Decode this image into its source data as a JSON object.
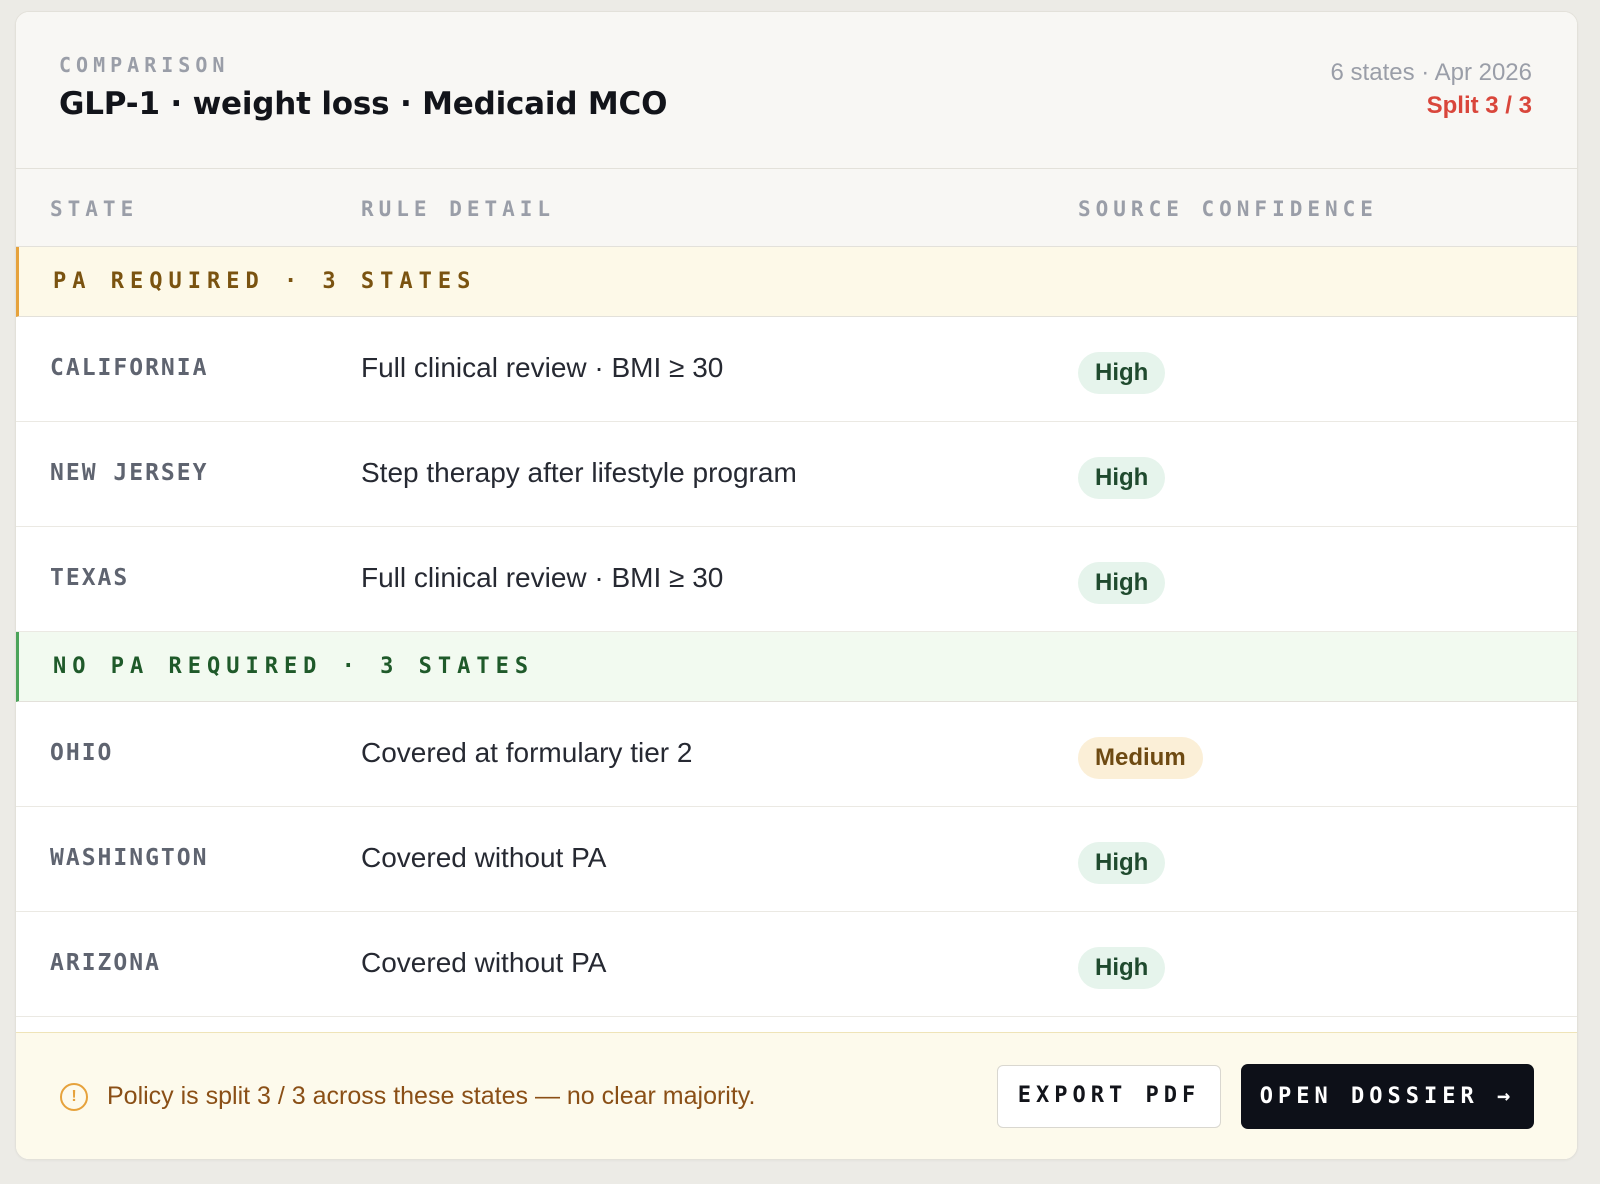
{
  "header": {
    "eyebrow": "COMPARISON",
    "title": "GLP-1 · weight loss · Medicaid MCO",
    "meta": "6 states · Apr 2026",
    "split": "Split 3 / 3"
  },
  "columns": {
    "state": "STATE",
    "rule": "RULE DETAIL",
    "confidence": "SOURCE CONFIDENCE"
  },
  "groups": [
    {
      "label": "PA REQUIRED · 3 STATES",
      "rows": [
        {
          "state": "CALIFORNIA",
          "rule": "Full clinical review · BMI ≥ 30",
          "confidence": "High"
        },
        {
          "state": "NEW JERSEY",
          "rule": "Step therapy after lifestyle program",
          "confidence": "High"
        },
        {
          "state": "TEXAS",
          "rule": "Full clinical review · BMI ≥ 30",
          "confidence": "High"
        }
      ]
    },
    {
      "label": "NO PA REQUIRED · 3 STATES",
      "rows": [
        {
          "state": "OHIO",
          "rule": "Covered at formulary tier 2",
          "confidence": "Medium"
        },
        {
          "state": "WASHINGTON",
          "rule": "Covered without PA",
          "confidence": "High"
        },
        {
          "state": "ARIZONA",
          "rule": "Covered without PA",
          "confidence": "High"
        }
      ]
    }
  ],
  "footer": {
    "icon": "alert-circle-icon",
    "message": "Policy is split 3 / 3 across these states — no clear majority.",
    "export_label": "EXPORT PDF",
    "open_label": "OPEN DOSSIER →"
  },
  "colors": {
    "split_accent": "#d9463b",
    "pa_accent": "#e6a23c",
    "no_pa_accent": "#4ba35a",
    "primary_button": "#0d1018"
  }
}
